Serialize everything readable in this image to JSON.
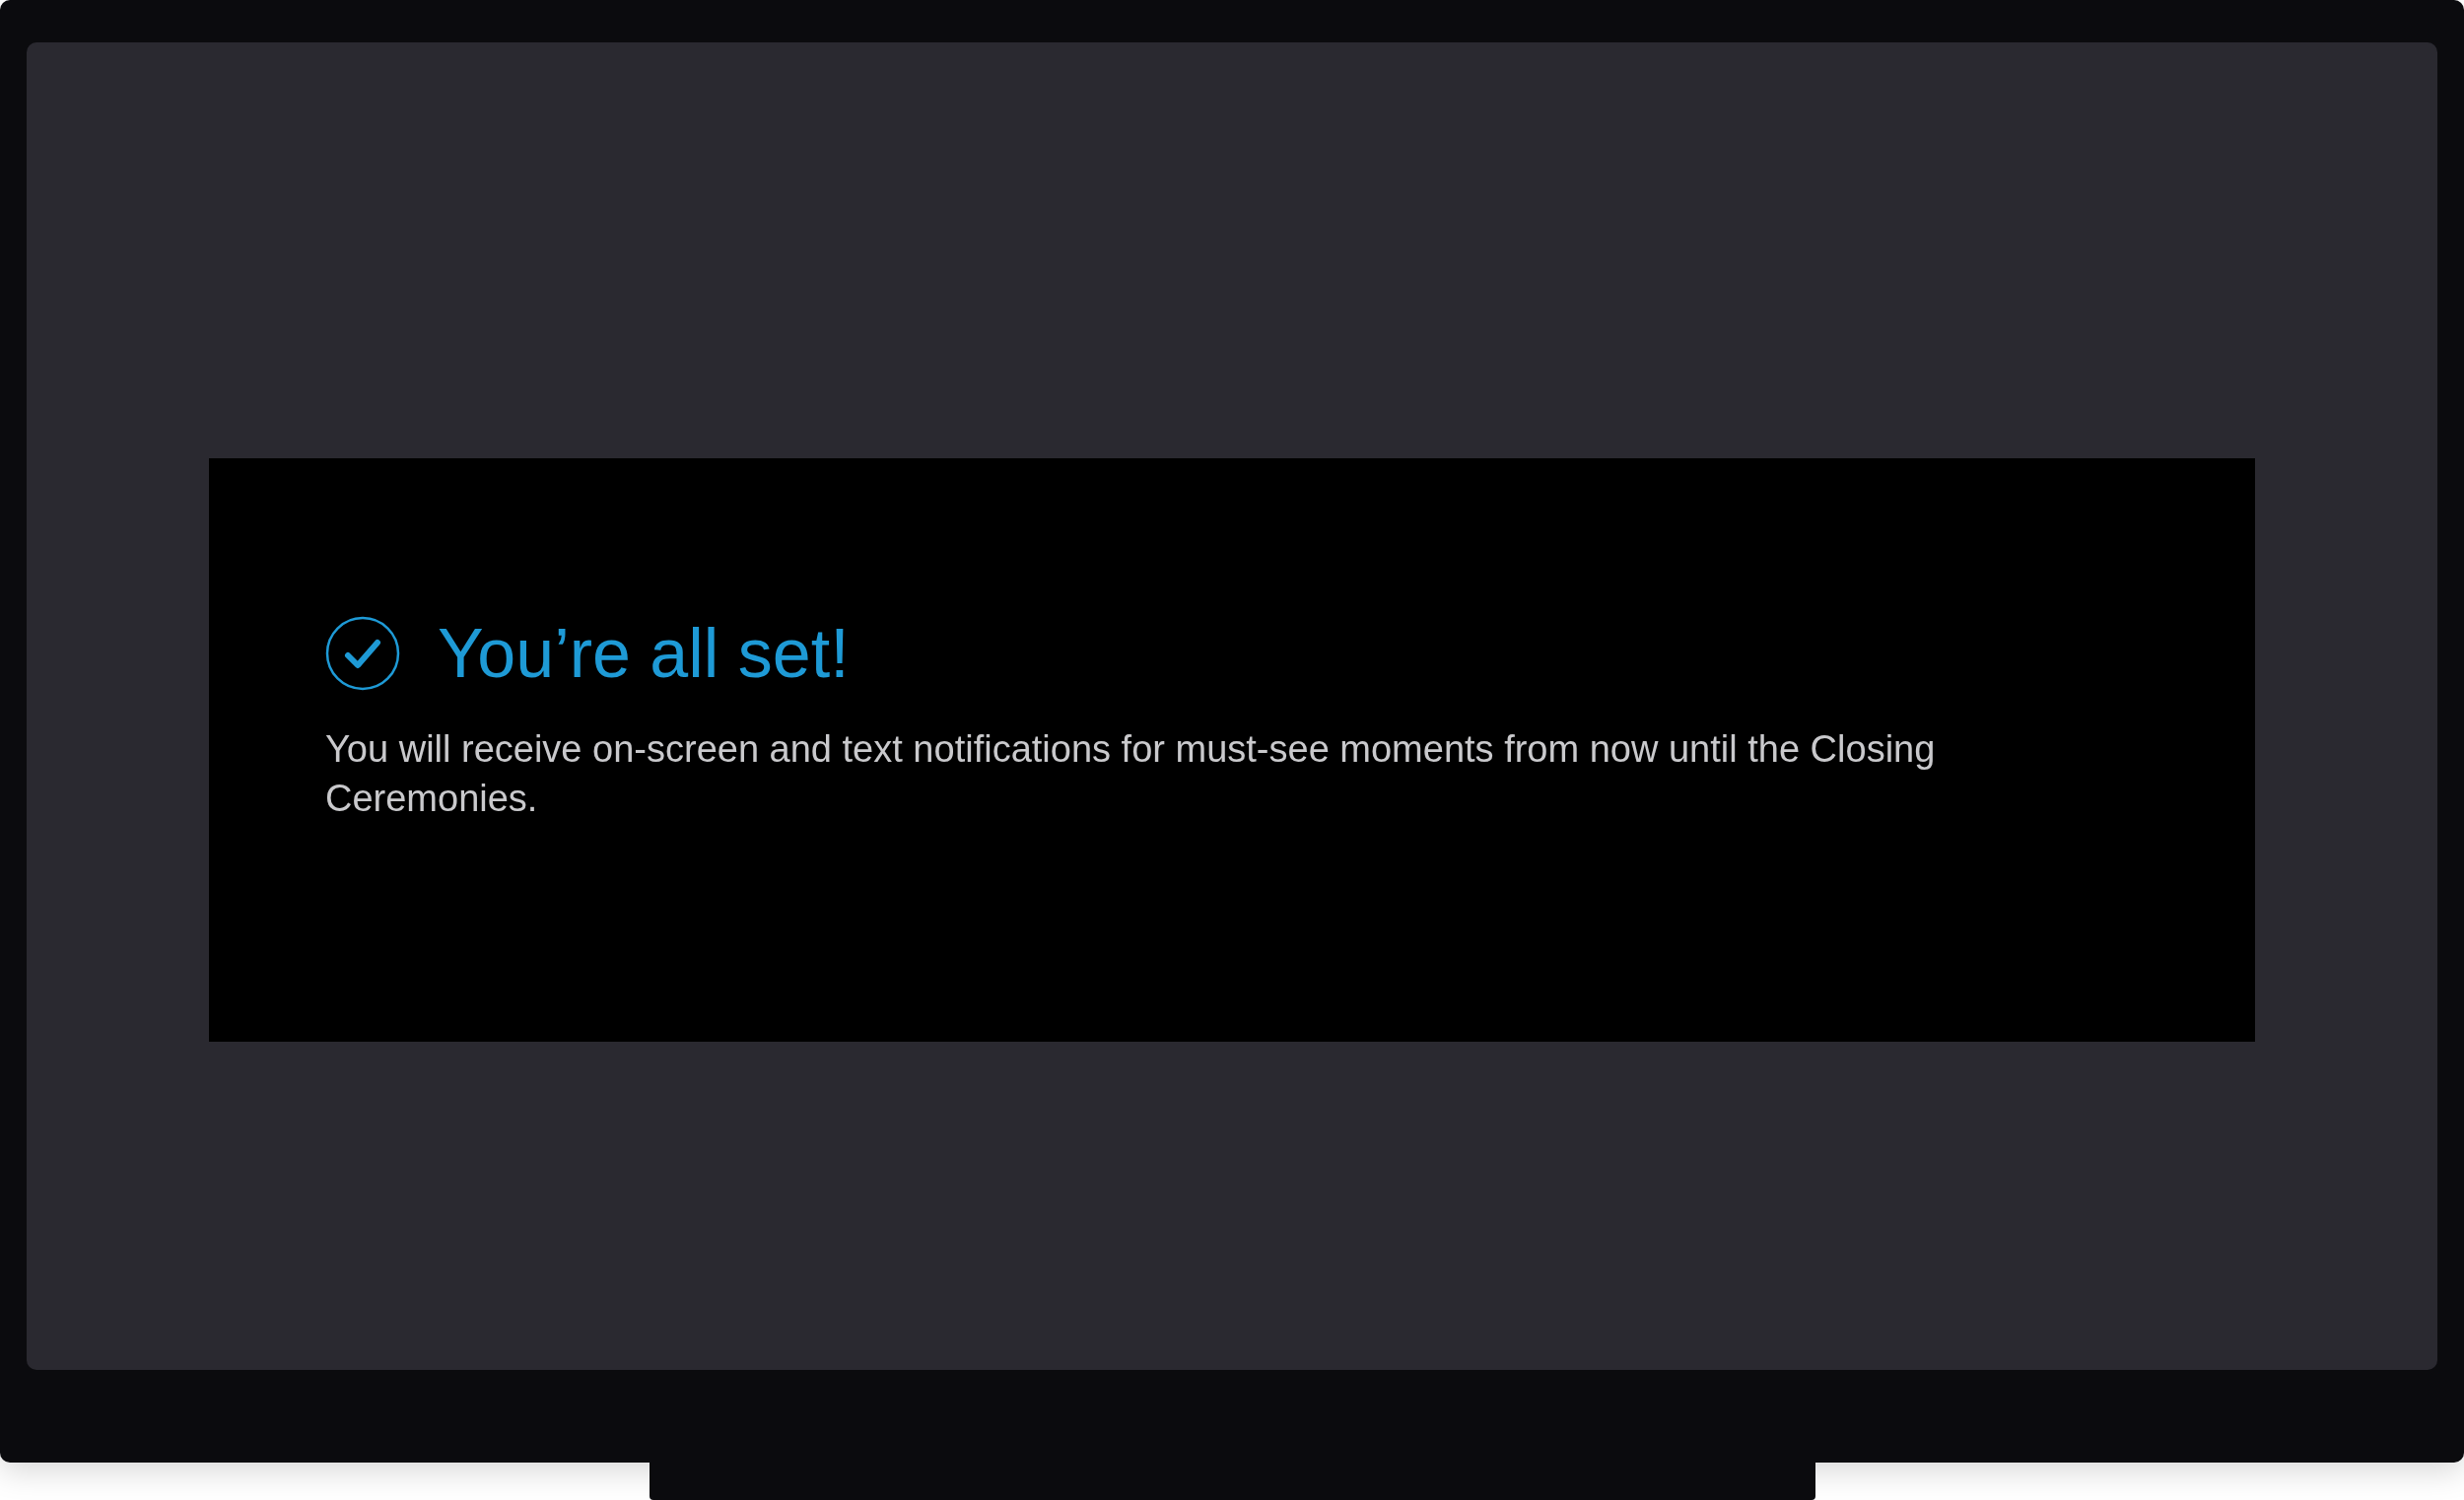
{
  "dialog": {
    "title": "You’re all set!",
    "message": "You will receive on-screen and text notifications for must-see moments from now until the Closing Ceremonies."
  }
}
